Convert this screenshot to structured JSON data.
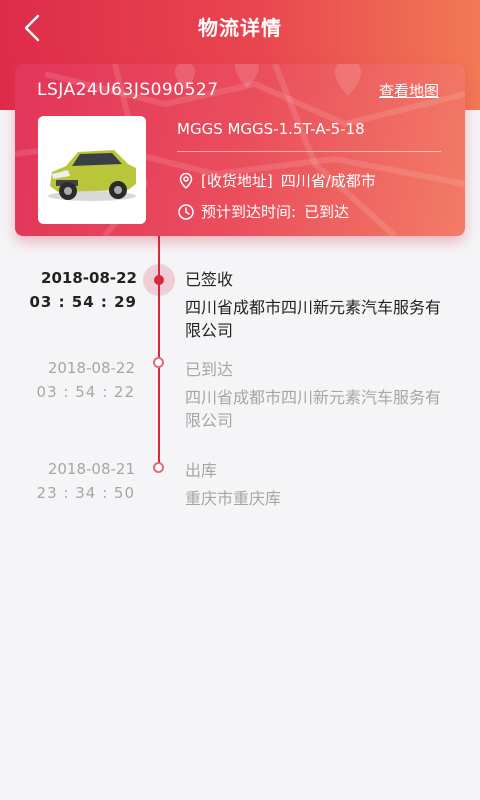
{
  "header": {
    "title": "物流详情",
    "back_icon": "back-arrow-icon"
  },
  "card": {
    "vin": "LSJA24U63JS090527",
    "map_link": "查看地图",
    "model": "MGGS MGGS-1.5T-A-5-18",
    "address_label": "[收货地址]",
    "address_value": "四川省/成都市",
    "eta_label": "预计到达时间:",
    "eta_value": "已到达",
    "colors": {
      "gradient_start": "#e2355a",
      "gradient_end": "#f27c66"
    }
  },
  "timeline": [
    {
      "date": "2018-08-22",
      "time": "03 : 54 : 29",
      "status": "已签收",
      "place": "四川省成都市四川新元素汽车服务有限公司",
      "active": true
    },
    {
      "date": "2018-08-22",
      "time": "03 : 54 : 22",
      "status": "已到达",
      "place": "四川省成都市四川新元素汽车服务有限公司",
      "active": false
    },
    {
      "date": "2018-08-21",
      "time": "23 : 34 : 50",
      "status": "出库",
      "place": "重庆市重庆库",
      "active": false
    }
  ],
  "accent_color": "#d9273d"
}
